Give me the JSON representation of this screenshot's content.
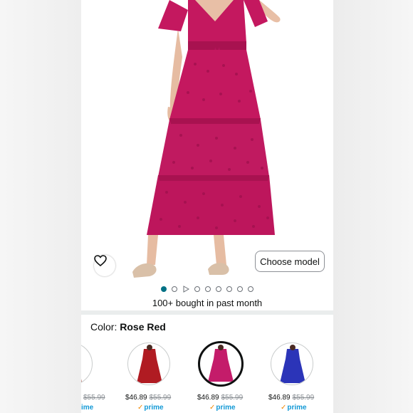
{
  "product_gallery": {
    "choose_model_label": "Choose model",
    "image_count": 9,
    "active_index": 0,
    "video_index": 2
  },
  "bought_text": "100+ bought in past month",
  "color_selector": {
    "label": "Color:",
    "selected_value": "Rose Red"
  },
  "swatches": [
    {
      "name": "brown",
      "color": "#9c3a2b",
      "price": "",
      "list_price": "$55.99",
      "prime": "ime",
      "selected": false
    },
    {
      "name": "red",
      "color": "#b01b22",
      "price": "$46.89",
      "list_price": "$55.99",
      "prime": "prime",
      "selected": false
    },
    {
      "name": "rose-red",
      "color": "#c41c6a",
      "price": "$46.89",
      "list_price": "$55.99",
      "prime": "prime",
      "selected": true
    },
    {
      "name": "blue",
      "color": "#2b34b8",
      "price": "$46.89",
      "list_price": "$55.99",
      "prime": "prime",
      "selected": false
    }
  ],
  "colors": {
    "dress": "#c4185f",
    "accent_teal": "#007185",
    "prime_blue": "#1399d6",
    "prime_check": "#f08804"
  },
  "icons": [
    "heart-icon",
    "play-icon",
    "prime-check-icon"
  ]
}
